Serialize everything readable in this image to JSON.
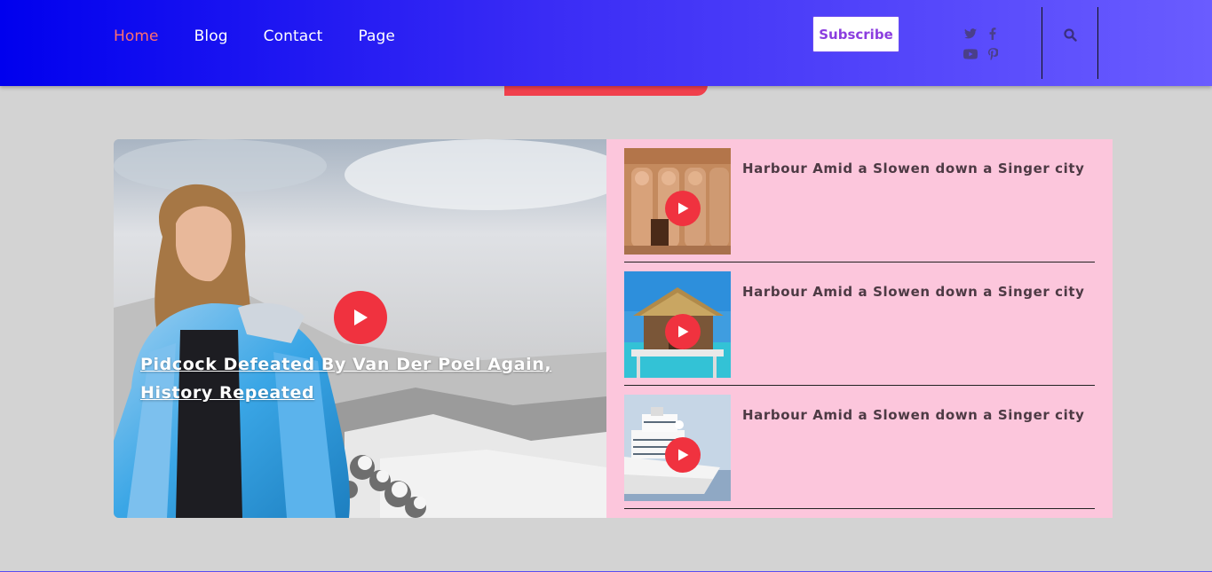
{
  "nav": {
    "items": [
      {
        "label": "Home",
        "active": true
      },
      {
        "label": "Blog",
        "active": false
      },
      {
        "label": "Contact",
        "active": false
      },
      {
        "label": "Page",
        "active": false
      }
    ],
    "subscribe_label": "Subscribe",
    "social_icons": [
      "twitter-icon",
      "facebook-icon",
      "youtube-icon",
      "pinterest-icon"
    ],
    "search_icon": "search-icon"
  },
  "colors": {
    "header_start": "#0000ee",
    "header_end": "#6a5cff",
    "accent_red": "#f0323f",
    "nav_active": "#ff6f6f",
    "side_panel_bg": "#fcc6dc",
    "page_bg": "#d3d3d3"
  },
  "feature": {
    "title": "Pidcock Defeated By Van Der Poel Again, History Repeated"
  },
  "side_list": [
    {
      "title": "Harbour Amid a Slowen down a Singer city",
      "thumb": "egypt-temple"
    },
    {
      "title": "Harbour Amid a Slowen down a Singer city",
      "thumb": "beach-hut"
    },
    {
      "title": "Harbour Amid a Slowen down a Singer city",
      "thumb": "cruise-ship"
    }
  ]
}
